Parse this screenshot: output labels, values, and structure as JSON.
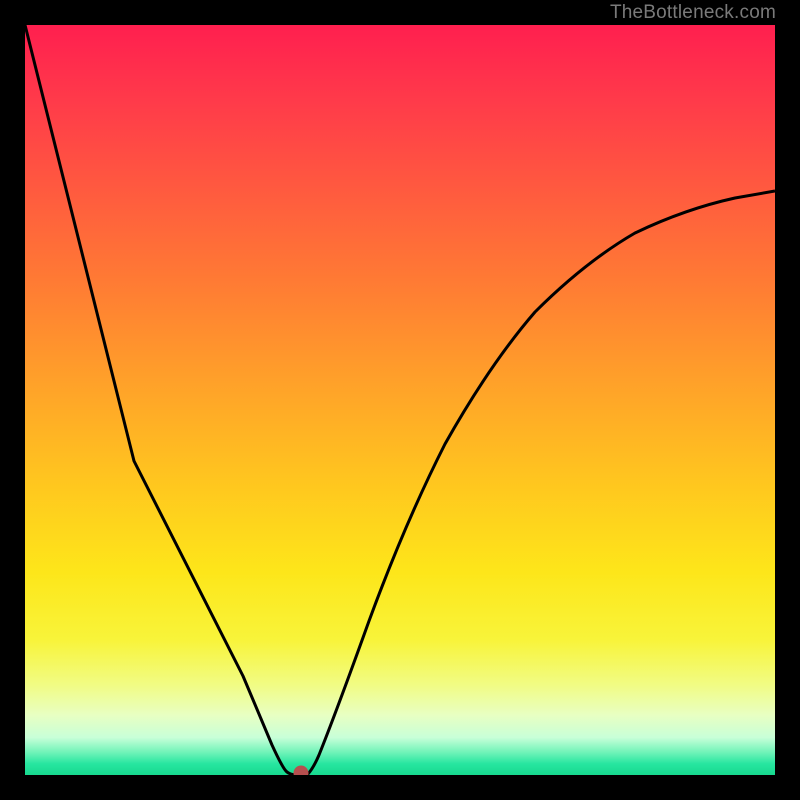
{
  "watermark": {
    "text": "TheBottleneck.com"
  },
  "chart_data": {
    "type": "line",
    "title": "",
    "xlabel": "",
    "ylabel": "",
    "xlim": [
      0,
      100
    ],
    "ylim": [
      0,
      100
    ],
    "grid": false,
    "legend": false,
    "background": "rainbow-gradient",
    "description": "V-shaped bottleneck deviation curve; minimum (0%) near x≈36, steep linear rise to ~100% at x=0, concave rise to ~72% at x=100.",
    "marker": {
      "x": 36.5,
      "y": 0,
      "color": "#b04a4a"
    },
    "series": [
      {
        "name": "bottleneck-curve",
        "x": [
          0,
          5,
          10,
          15,
          20,
          25,
          30,
          34,
          35,
          36.5,
          38,
          40,
          45,
          50,
          55,
          60,
          65,
          70,
          75,
          80,
          85,
          90,
          95,
          100
        ],
        "y": [
          100,
          86,
          72,
          58,
          44,
          30,
          16,
          4.5,
          2,
          0,
          0.5,
          5,
          18,
          29,
          38,
          46,
          52,
          57,
          61,
          64.5,
          67,
          69,
          70.5,
          72
        ]
      }
    ]
  }
}
